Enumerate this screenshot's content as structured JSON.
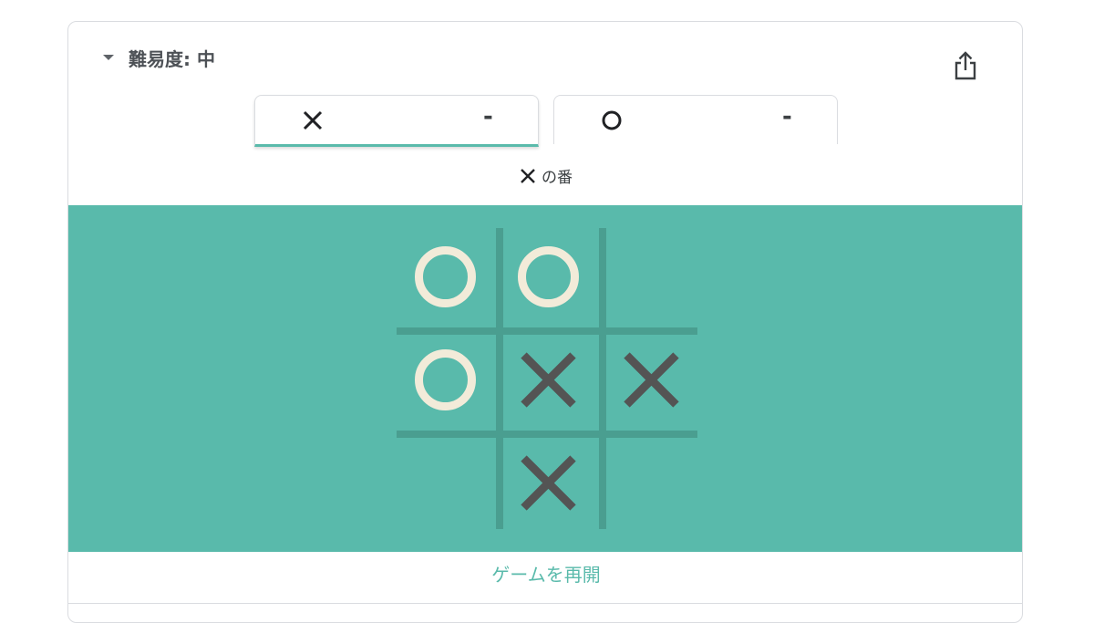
{
  "header": {
    "difficulty_label": "難易度: 中",
    "share_icon": "share-icon"
  },
  "players": [
    {
      "mark": "X",
      "score": "-",
      "active": true
    },
    {
      "mark": "O",
      "score": "-",
      "active": false
    }
  ],
  "turn": {
    "mark": "X",
    "text": "の番"
  },
  "board": {
    "cells": [
      "O",
      "O",
      "",
      "O",
      "X",
      "X",
      "",
      "X",
      ""
    ],
    "colors": {
      "background": "#59baab",
      "grid": "#4a9e90",
      "o_mark": "#f2ebd9",
      "x_mark": "#545454"
    }
  },
  "footer": {
    "resume_label": "ゲームを再開"
  },
  "colors": {
    "accent": "#5abaab"
  }
}
